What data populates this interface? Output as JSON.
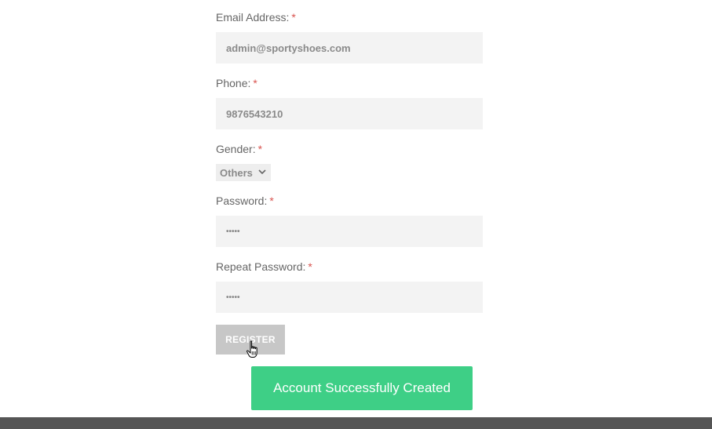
{
  "form": {
    "email": {
      "label": "Email Address:",
      "required_mark": "*",
      "value": "admin@sportyshoes.com"
    },
    "phone": {
      "label": "Phone:",
      "required_mark": "*",
      "value": "9876543210"
    },
    "gender": {
      "label": "Gender:",
      "required_mark": "*",
      "selected": "Others"
    },
    "password": {
      "label": "Password:",
      "required_mark": "*",
      "value": "•••••"
    },
    "repeat_password": {
      "label": "Repeat Password:",
      "required_mark": "*",
      "value": "•••••"
    },
    "register_label": "REGISTER"
  },
  "toast": {
    "message": "Account Successfully Created"
  },
  "colors": {
    "required": "#d9534f",
    "toast_bg": "#3ecf86",
    "button_bg": "#c7c7c7",
    "input_bg": "#f3f3f3",
    "footer_bg": "#555555"
  },
  "icons": {
    "select_arrow": "chevron-down-icon",
    "cursor": "hand-pointer-icon"
  }
}
